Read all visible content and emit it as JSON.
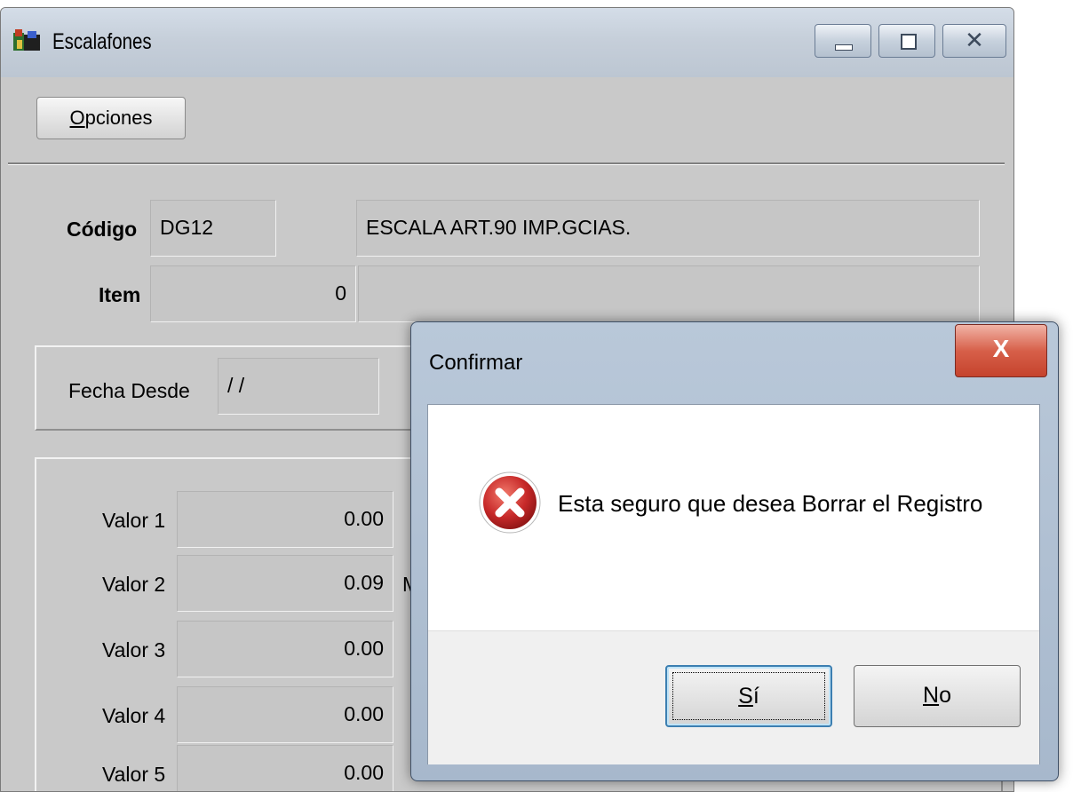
{
  "window": {
    "title": "Escalafones",
    "controls": [
      "minimize",
      "maximize",
      "close"
    ],
    "close_glyph": "✕"
  },
  "toolbar": {
    "opciones": {
      "first": "O",
      "rest": "pciones"
    }
  },
  "form": {
    "codigo_label": "Código",
    "codigo_value": "DG12",
    "descripcion_value": "ESCALA ART.90 IMP.GCIAS.",
    "item_label": "Item",
    "item_value": "0",
    "item_desc_value": "",
    "fecha_label": "Fecha Desde",
    "fecha_value": "/ /",
    "valores": [
      {
        "label": "Valor 1",
        "value": "0.00"
      },
      {
        "label": "Valor 2",
        "value": "0.09"
      },
      {
        "label": "Valor 3",
        "value": "0.00"
      },
      {
        "label": "Valor 4",
        "value": "0.00"
      },
      {
        "label": "Valor 5",
        "value": "0.00"
      }
    ],
    "valor2_trailing": "M"
  },
  "dialog": {
    "title": "Confirmar",
    "close_glyph": "X",
    "icon": "error-icon",
    "message": "Esta seguro que desea Borrar el Registro",
    "yes": {
      "first": "S",
      "rest": "í"
    },
    "no": {
      "first": "N",
      "rest": "o"
    }
  },
  "colors": {
    "window_bg": "#c9c9c9",
    "titlebar": "#c6cfda",
    "dialog_frame": "#a7b8cc",
    "close_red": "#c5432d",
    "error_red": "#c72929"
  }
}
